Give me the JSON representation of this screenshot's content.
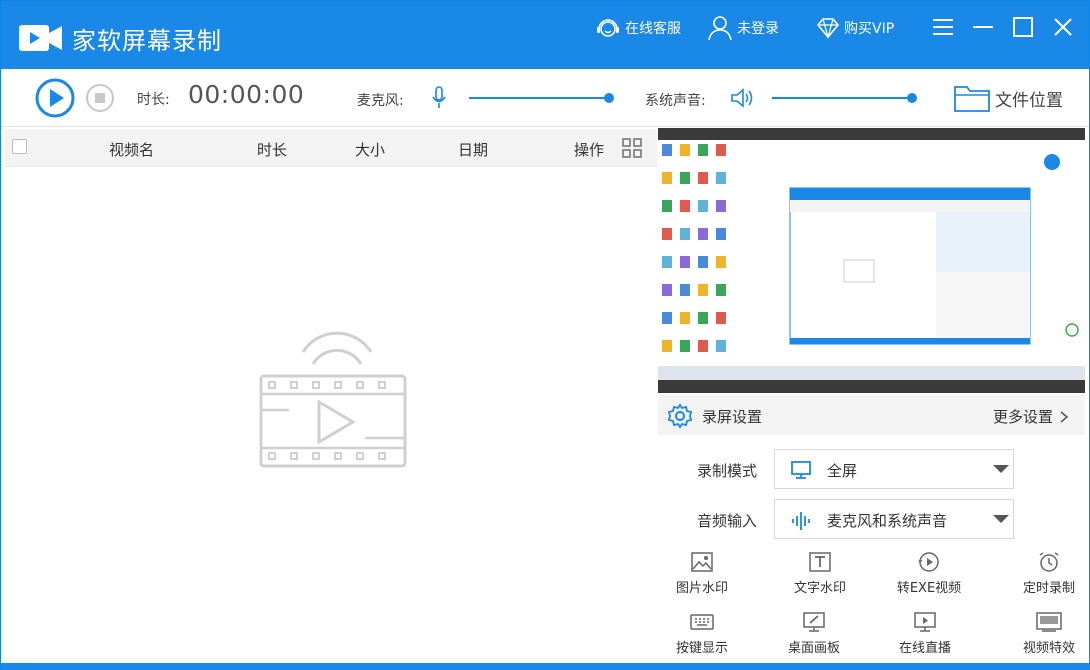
{
  "titlebar": {
    "app_title": "家软屏幕录制",
    "service": "在线客服",
    "login": "未登录",
    "vip": "购买VIP",
    "icons": [
      "video-logo-icon",
      "headset-icon",
      "user-icon",
      "diamond-icon",
      "menu-icon",
      "minimize-icon",
      "maximize-icon",
      "close-icon"
    ],
    "accent": "#1a88e6"
  },
  "toolbar": {
    "duration_label": "时长:",
    "timer": "00:00:00",
    "mic_label": "麦克风:",
    "system_sound_label": "系统声音:",
    "mic_volume": 1.0,
    "system_volume": 1.0,
    "folder_label": "文件位置"
  },
  "list": {
    "columns": [
      "视频名",
      "时长",
      "大小",
      "日期",
      "操作"
    ],
    "rows": []
  },
  "settings": {
    "title": "录屏设置",
    "more": "更多设置",
    "record_mode_label": "录制模式",
    "record_mode_value": "全屏",
    "audio_input_label": "音频输入",
    "audio_input_value": "麦克风和系统声音"
  },
  "tools": [
    {
      "label": "图片水印",
      "icon": "image-icon"
    },
    {
      "label": "文字水印",
      "icon": "text-icon"
    },
    {
      "label": "转EXE视频",
      "icon": "convert-icon"
    },
    {
      "label": "定时录制",
      "icon": "alarm-icon"
    },
    {
      "label": "按键显示",
      "icon": "keyboard-icon"
    },
    {
      "label": "桌面画板",
      "icon": "pen-board-icon"
    },
    {
      "label": "在线直播",
      "icon": "live-icon"
    },
    {
      "label": "视频特效",
      "icon": "effects-icon"
    }
  ]
}
